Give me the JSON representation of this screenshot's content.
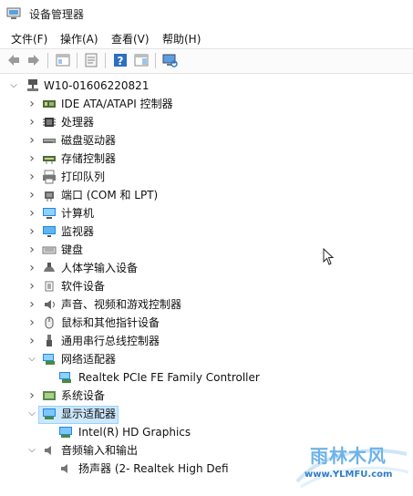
{
  "window": {
    "title": "设备管理器"
  },
  "menu": [
    {
      "label": "文件(F)"
    },
    {
      "label": "操作(A)"
    },
    {
      "label": "查看(V)"
    },
    {
      "label": "帮助(H)"
    }
  ],
  "tree": {
    "root": "W10-01606220821",
    "items": [
      {
        "label": "IDE ATA/ATAPI 控制器",
        "icon": "ide-controller-icon",
        "expanded": false
      },
      {
        "label": "处理器",
        "icon": "processor-icon",
        "expanded": false
      },
      {
        "label": "磁盘驱动器",
        "icon": "disk-drive-icon",
        "expanded": false
      },
      {
        "label": "存储控制器",
        "icon": "storage-controller-icon",
        "expanded": false
      },
      {
        "label": "打印队列",
        "icon": "print-queue-icon",
        "expanded": false
      },
      {
        "label": "端口 (COM 和 LPT)",
        "icon": "port-icon",
        "expanded": false
      },
      {
        "label": "计算机",
        "icon": "computer-icon",
        "expanded": false
      },
      {
        "label": "监视器",
        "icon": "monitor-icon",
        "expanded": false
      },
      {
        "label": "键盘",
        "icon": "keyboard-icon",
        "expanded": false
      },
      {
        "label": "人体学输入设备",
        "icon": "hid-icon",
        "expanded": false
      },
      {
        "label": "软件设备",
        "icon": "software-device-icon",
        "expanded": false
      },
      {
        "label": "声音、视频和游戏控制器",
        "icon": "sound-icon",
        "expanded": false
      },
      {
        "label": "鼠标和其他指针设备",
        "icon": "mouse-icon",
        "expanded": false
      },
      {
        "label": "通用串行总线控制器",
        "icon": "usb-icon",
        "expanded": false
      },
      {
        "label": "网络适配器",
        "icon": "network-adapter-icon",
        "expanded": true
      },
      {
        "label": "Realtek PCIe FE Family Controller",
        "icon": "network-adapter-icon",
        "child": true
      },
      {
        "label": "系统设备",
        "icon": "system-device-icon",
        "expanded": false
      },
      {
        "label": "显示适配器",
        "icon": "display-adapter-icon",
        "expanded": true,
        "selected": true
      },
      {
        "label": "Intel(R) HD Graphics",
        "icon": "display-adapter-icon",
        "child": true
      },
      {
        "label": "音频输入和输出",
        "icon": "speaker-icon",
        "expanded": true
      },
      {
        "label": "扬声器 (2- Realtek High Defi",
        "icon": "speaker-icon",
        "child": true
      }
    ]
  },
  "watermark": {
    "main": "雨林木风",
    "sub": "www.YLMFU.com"
  },
  "colors": {
    "selection": "#cce8ff",
    "selection_border": "#99d1ff",
    "icon_blue": "#2a7fd4"
  }
}
